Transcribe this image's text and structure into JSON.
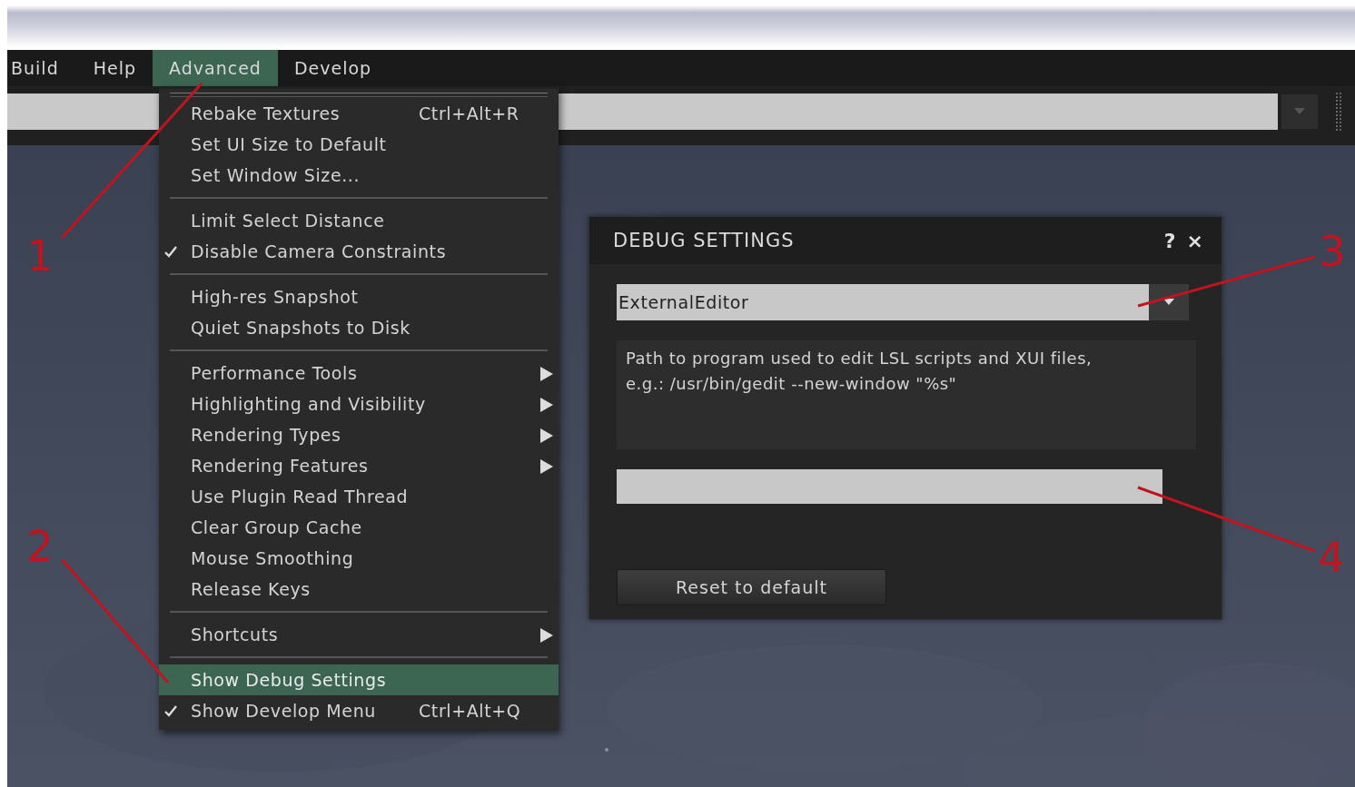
{
  "menu_bar": {
    "items": [
      {
        "label": "Build",
        "selected": false
      },
      {
        "label": "Help",
        "selected": false
      },
      {
        "label": "Advanced",
        "selected": true
      },
      {
        "label": "Develop",
        "selected": false
      }
    ]
  },
  "advanced_menu": {
    "groups": [
      {
        "items": [
          {
            "label": "Rebake Textures",
            "shortcut": "Ctrl+Alt+R",
            "checked": false,
            "submenu": false,
            "selected": false
          },
          {
            "label": "Set UI Size to Default",
            "checked": false,
            "submenu": false,
            "selected": false
          },
          {
            "label": "Set Window Size...",
            "checked": false,
            "submenu": false,
            "selected": false
          }
        ]
      },
      {
        "items": [
          {
            "label": "Limit Select Distance",
            "checked": false,
            "submenu": false,
            "selected": false
          },
          {
            "label": "Disable Camera Constraints",
            "checked": true,
            "submenu": false,
            "selected": false
          }
        ]
      },
      {
        "items": [
          {
            "label": "High-res Snapshot",
            "checked": false,
            "submenu": false,
            "selected": false
          },
          {
            "label": "Quiet Snapshots to Disk",
            "checked": false,
            "submenu": false,
            "selected": false
          }
        ]
      },
      {
        "items": [
          {
            "label": "Performance Tools",
            "checked": false,
            "submenu": true,
            "selected": false
          },
          {
            "label": "Highlighting and Visibility",
            "checked": false,
            "submenu": true,
            "selected": false
          },
          {
            "label": "Rendering Types",
            "checked": false,
            "submenu": true,
            "selected": false
          },
          {
            "label": "Rendering Features",
            "checked": false,
            "submenu": true,
            "selected": false
          },
          {
            "label": "Use Plugin Read Thread",
            "checked": false,
            "submenu": false,
            "selected": false
          },
          {
            "label": "Clear Group Cache",
            "checked": false,
            "submenu": false,
            "selected": false
          },
          {
            "label": "Mouse Smoothing",
            "checked": false,
            "submenu": false,
            "selected": false
          },
          {
            "label": "Release Keys",
            "checked": false,
            "submenu": false,
            "selected": false
          }
        ]
      },
      {
        "items": [
          {
            "label": "Shortcuts",
            "checked": false,
            "submenu": true,
            "selected": false
          }
        ]
      },
      {
        "items": [
          {
            "label": "Show Debug Settings",
            "checked": false,
            "submenu": false,
            "selected": true
          },
          {
            "label": "Show Develop Menu",
            "shortcut": "Ctrl+Alt+Q",
            "checked": true,
            "submenu": false,
            "selected": false
          }
        ]
      }
    ]
  },
  "debug_settings": {
    "title": "DEBUG SETTINGS",
    "help": "?",
    "close": "×",
    "setting": "ExternalEditor",
    "description": "Path to program used to edit LSL scripts and XUI files, e.g.: /usr/bin/gedit --new-window \"%s\"",
    "reset_button": "Reset to default"
  },
  "annotations": [
    {
      "label": "1"
    },
    {
      "label": "2"
    },
    {
      "label": "3"
    },
    {
      "label": "4"
    }
  ]
}
